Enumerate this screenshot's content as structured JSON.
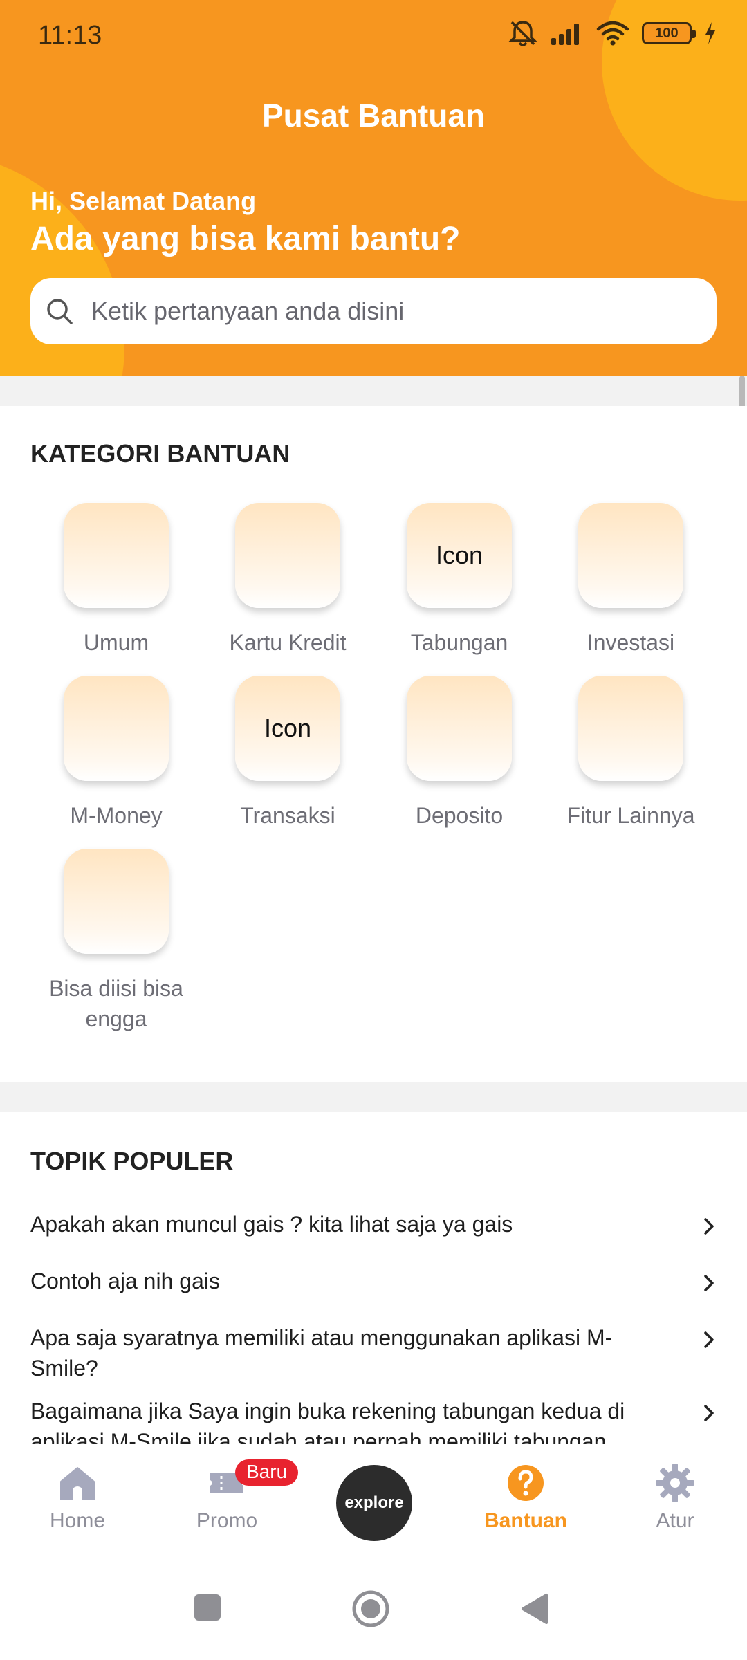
{
  "status_bar": {
    "time": "11:13",
    "battery": "100",
    "icons": [
      "mute-icon",
      "signal-icon",
      "wifi-icon",
      "battery-icon",
      "charging-icon"
    ]
  },
  "header": {
    "title": "Pusat Bantuan",
    "greeting": "Hi, Selamat Datang",
    "question": "Ada yang bisa kami bantu?",
    "search_placeholder": "Ketik pertanyaan anda disini"
  },
  "kategori": {
    "title": "KATEGORI BANTUAN",
    "items": [
      {
        "label": "Umum",
        "icon_text": ""
      },
      {
        "label": "Kartu Kredit",
        "icon_text": ""
      },
      {
        "label": "Tabungan",
        "icon_text": "Icon"
      },
      {
        "label": "Investasi",
        "icon_text": ""
      },
      {
        "label": "M-Money",
        "icon_text": ""
      },
      {
        "label": "Transaksi",
        "icon_text": "Icon"
      },
      {
        "label": "Deposito",
        "icon_text": ""
      },
      {
        "label": "Fitur Lainnya",
        "icon_text": ""
      },
      {
        "label": "Bisa diisi bisa engga",
        "icon_text": ""
      }
    ]
  },
  "topik": {
    "title": "TOPIK POPULER",
    "items": [
      "Apakah akan muncul gais ? kita lihat saja ya gais",
      "Contoh aja nih gais",
      "Apa saja syaratnya memiliki atau menggunakan aplikasi M-Smile?",
      "Bagaimana jika Saya ingin buka rekening tabungan kedua di aplikasi M-Smile jika sudah atau pernah memiliki tabungan"
    ]
  },
  "bottom_nav": {
    "items": [
      {
        "label": "Home",
        "icon": "home-icon"
      },
      {
        "label": "Promo",
        "icon": "ticket-icon",
        "badge": "Baru"
      },
      {
        "label": "explore",
        "icon": "explore-button"
      },
      {
        "label": "Bantuan",
        "icon": "help-icon",
        "active": true
      },
      {
        "label": "Atur",
        "icon": "gear-icon"
      }
    ]
  },
  "colors": {
    "primary": "#f7961f",
    "accent": "#fcb01a",
    "badge": "#e8232f",
    "inactive": "#8e8e99"
  }
}
